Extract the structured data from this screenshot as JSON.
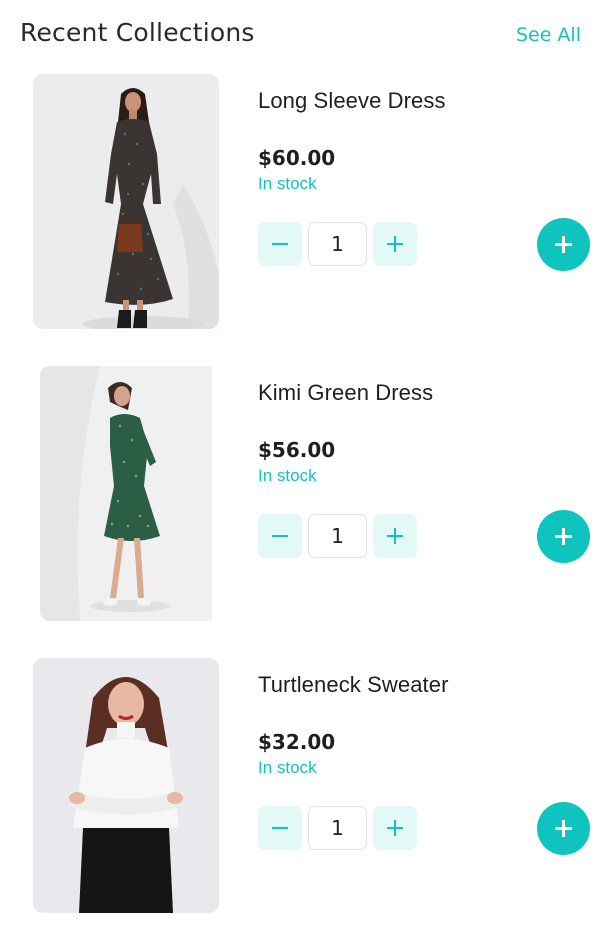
{
  "header": {
    "title": "Recent Collections",
    "see_all": "See All"
  },
  "colors": {
    "accent": "#14c2bd",
    "accent_light": "#e3f9f8",
    "add_button": "#0fc4be"
  },
  "products": [
    {
      "name": "Long Sleeve Dress",
      "price": "$60.00",
      "stock": "In stock",
      "quantity": "1",
      "image": "woman-in-dark-printed-midi-dress-with-brown-handbag"
    },
    {
      "name": "Kimi Green Dress",
      "price": "$56.00",
      "stock": "In stock",
      "quantity": "1",
      "image": "woman-in-green-patterned-mini-dress-looking-back"
    },
    {
      "name": "Turtleneck Sweater",
      "price": "$32.00",
      "stock": "In stock",
      "quantity": "1",
      "image": "woman-in-white-turtleneck-sweater-arms-crossed"
    }
  ]
}
